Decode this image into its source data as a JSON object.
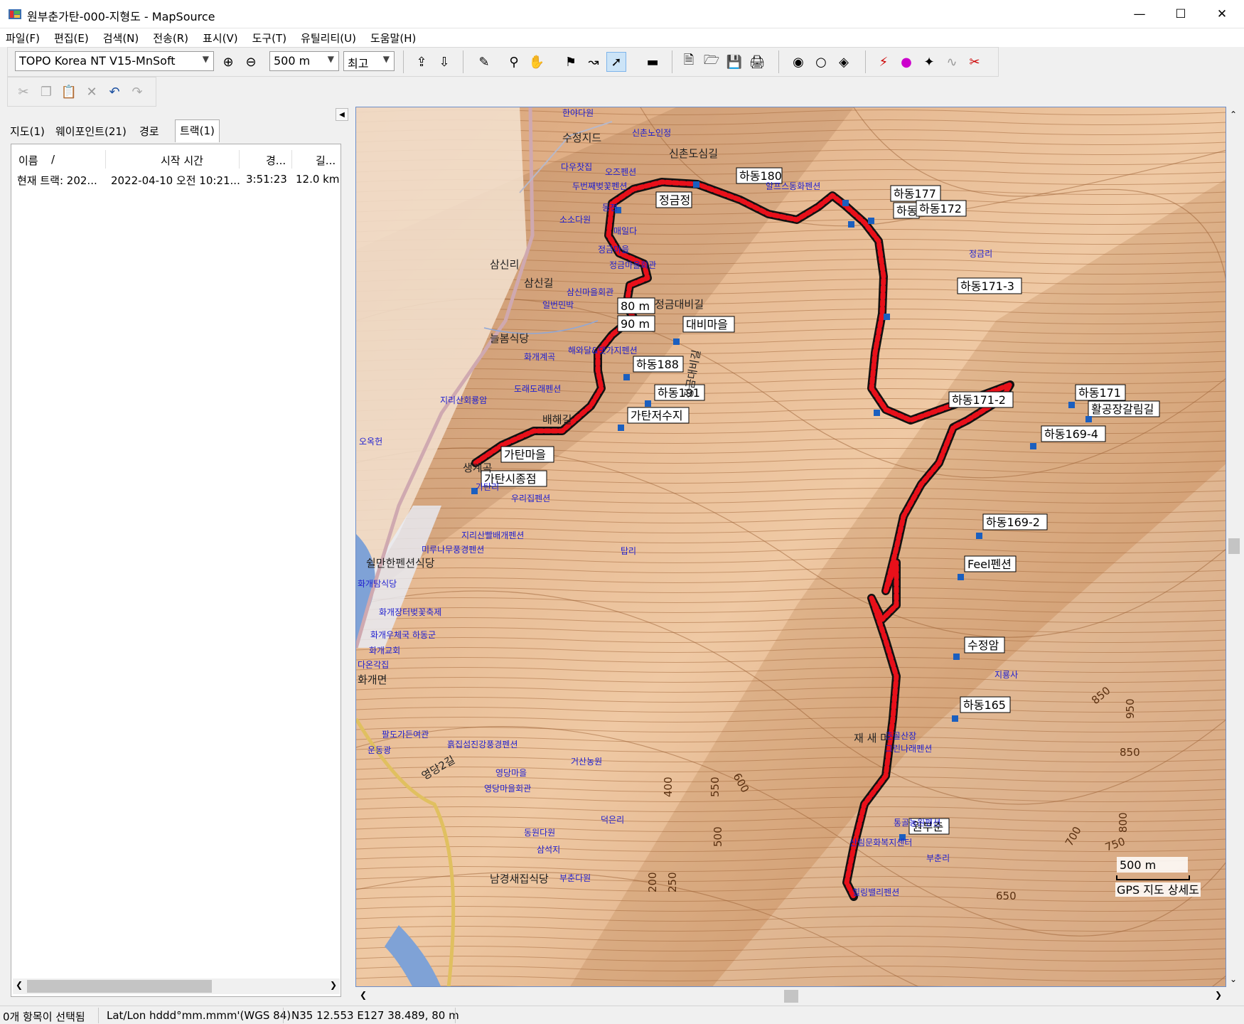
{
  "window": {
    "title": "원부춘가탄-000-지형도 - MapSource"
  },
  "menu": [
    "파일(F)",
    "편집(E)",
    "검색(N)",
    "전송(R)",
    "표시(V)",
    "도구(T)",
    "유틸리티(U)",
    "도움말(H)"
  ],
  "toolbar": {
    "map_product": "TOPO Korea NT V15-MnSoft",
    "zoom_scale": "500 m",
    "detail": "최고"
  },
  "tabs": [
    "지도(1)",
    "웨이포인트(21)",
    "경로",
    "트랙(1)"
  ],
  "active_tab": "트랙(1)",
  "track_list": {
    "headers": [
      "이름",
      "/",
      "시작 시간",
      "경...",
      "길..."
    ],
    "rows": [
      {
        "name": "현재 트랙: 202...",
        "start": "2022-04-10 오전 10:21...",
        "duration": "3:51:23",
        "length": "12.0 km"
      }
    ]
  },
  "map": {
    "waypoints": [
      "하동180",
      "정금정",
      "하동177",
      "하동",
      "하동172",
      "하동171-3",
      "80 m",
      "90 m",
      "대비마을",
      "하동188",
      "하동191",
      "가탄저수지",
      "하동171-2",
      "하동171",
      "활공장갈림길",
      "하동169-4",
      "가탄마을",
      "가탄시종점",
      "하동169-2",
      "Feel펜션",
      "수정암",
      "하동165",
      "원부춘"
    ],
    "place_labels": [
      "한야다원",
      "수정지드",
      "신촌노인정",
      "신촌도심길",
      "다우찻집",
      "오즈펜션",
      "두번째벚꽃펜션",
      "알프스동화펜션",
      "동전",
      "소소다원",
      "매일다",
      "정금마을",
      "정금마을회관",
      "삼신리",
      "삼신길",
      "삼신마을회관",
      "일번민박",
      "정금대비길",
      "늘봄식당",
      "화개계곡",
      "해와달&댓가지펜션",
      "도래도래펜션",
      "지리산회룡암",
      "정금대비길",
      "배해길",
      "오옥헌",
      "생계곡",
      "가탄리",
      "우리집펜션",
      "지리산빨배개펜션",
      "미루나무풍경펜션",
      "쉴만한펜션식당",
      "화개탐식당",
      "탑리",
      "화개장터벚꽃축제",
      "화개우체국 하동군",
      "화개교회",
      "다온각집",
      "화개면",
      "팔도가든여관",
      "흙집섬진강풍경펜션",
      "운동광",
      "영당2길",
      "거산농원",
      "영당마을",
      "영당마을회관",
      "덕은리",
      "동원다원",
      "삼석지",
      "남경새집식당",
      "부춘다원",
      "정금리",
      "지룡사",
      "춘골산장",
      "그린나래펜션",
      "재 새 마",
      "통골농원펜션",
      "산림문화복지센터",
      "부춘리",
      "힐링밸리펜션"
    ],
    "contour_labels": [
      "850",
      "950",
      "850",
      "800",
      "750",
      "700",
      "650",
      "600",
      "550",
      "500",
      "400",
      "250",
      "200"
    ],
    "scale_bar": "500 m",
    "detail_label": "GPS 지도 상세도"
  },
  "status": {
    "selection": "0개 항목이 선택됨",
    "coord_format": "Lat/Lon hddd°mm.mmm'(WGS 84)",
    "cursor": "N35 12.553 E127 38.489, 80 m"
  },
  "colors": {
    "track": "#e8101a",
    "terrain_light": "#f2d2b0",
    "terrain_dark": "#b57a4a",
    "water": "#7fa2d6",
    "road": "#e0c060"
  }
}
